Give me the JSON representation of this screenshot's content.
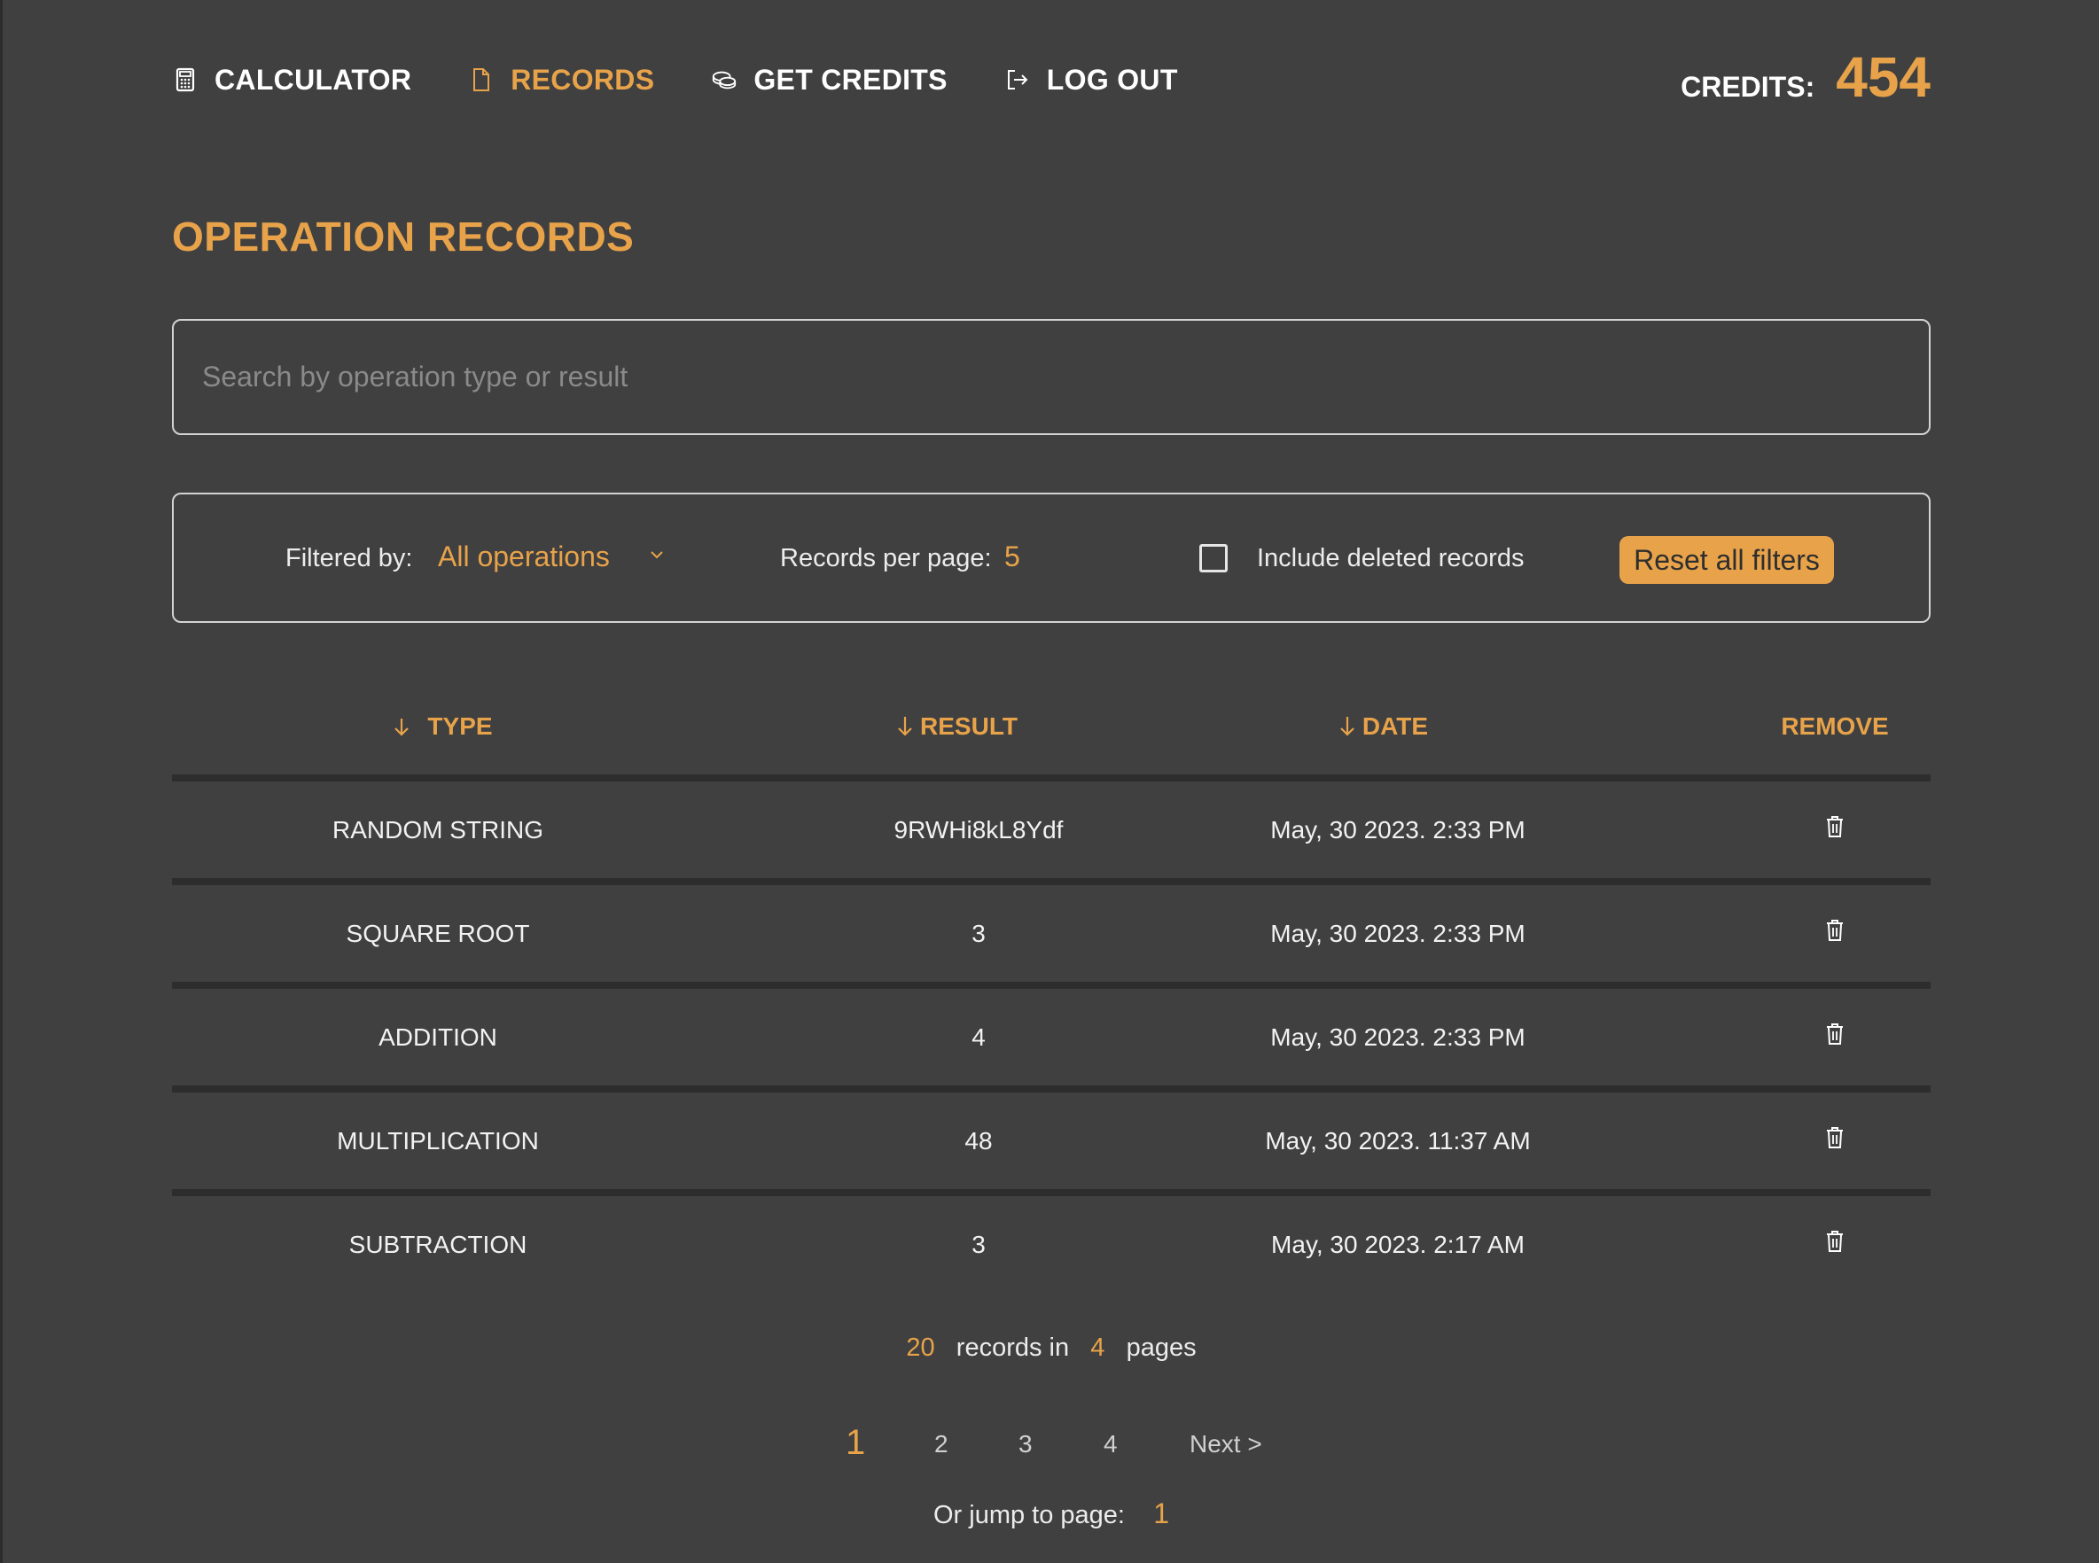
{
  "nav": {
    "items": [
      {
        "label": "CALCULATOR",
        "icon": "calculator-icon"
      },
      {
        "label": "RECORDS",
        "icon": "document-icon",
        "active": true
      },
      {
        "label": "GET CREDITS",
        "icon": "coins-icon"
      },
      {
        "label": "LOG OUT",
        "icon": "logout-icon"
      }
    ]
  },
  "credits": {
    "label": "CREDITS:",
    "value": "454"
  },
  "page": {
    "title": "OPERATION RECORDS"
  },
  "search": {
    "placeholder": "Search by operation type or result",
    "value": ""
  },
  "filters": {
    "filtered_by_label": "Filtered by:",
    "operation_value": "All operations",
    "records_per_page_label": "Records per page:",
    "records_per_page_value": "5",
    "include_deleted_label": "Include deleted records",
    "include_deleted_checked": false,
    "reset_label": "Reset all filters"
  },
  "table": {
    "columns": [
      "TYPE",
      "RESULT",
      "DATE",
      "REMOVE"
    ],
    "rows": [
      {
        "type": "RANDOM STRING",
        "result": "9RWHi8kL8Ydf",
        "date": "May, 30 2023. 2:33 PM"
      },
      {
        "type": "SQUARE ROOT",
        "result": "3",
        "date": "May, 30 2023. 2:33 PM"
      },
      {
        "type": "ADDITION",
        "result": "4",
        "date": "May, 30 2023. 2:33 PM"
      },
      {
        "type": "MULTIPLICATION",
        "result": "48",
        "date": "May, 30 2023. 11:37 AM"
      },
      {
        "type": "SUBTRACTION",
        "result": "3",
        "date": "May, 30 2023. 2:17 AM"
      }
    ]
  },
  "summary": {
    "count": "20",
    "records_in": "records in",
    "pages": "4",
    "pages_label": "pages"
  },
  "pagination": {
    "current": "1",
    "pages": [
      "2",
      "3",
      "4"
    ],
    "next": "Next >"
  },
  "jump": {
    "label": "Or jump to page:",
    "value": "1"
  },
  "colors": {
    "accent": "#e8a34a",
    "background": "#404040",
    "rule": "#2d2d2d"
  }
}
